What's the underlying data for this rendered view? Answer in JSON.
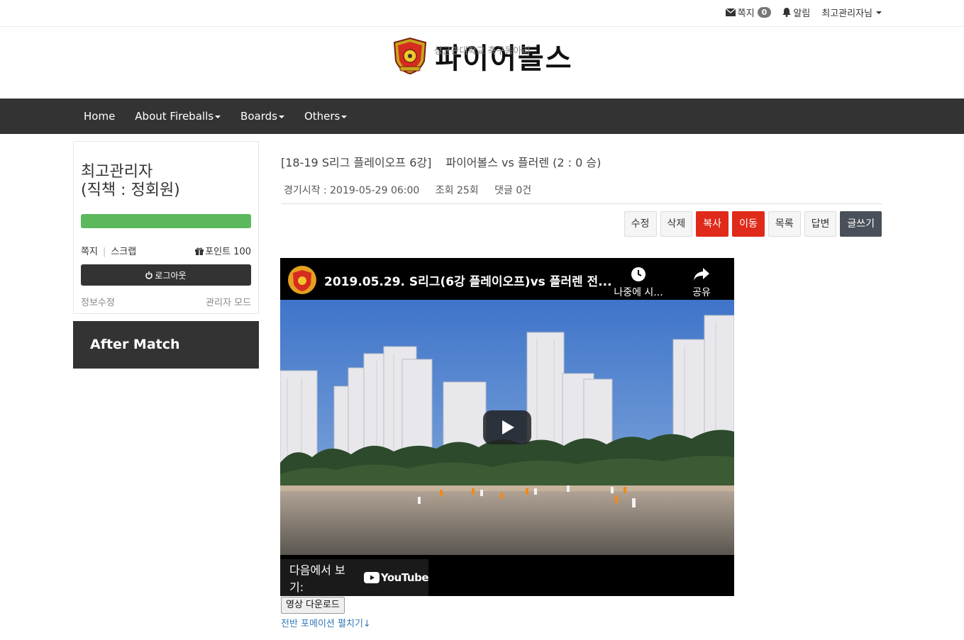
{
  "topbar": {
    "messages_label": "쪽지",
    "messages_count": "0",
    "alerts_label": "알림",
    "user_label": "최고관리자님"
  },
  "brand": {
    "title": "파이어볼스",
    "subtitle": "성균관대학교 축구동아리"
  },
  "nav": {
    "items": [
      {
        "label": "Home"
      },
      {
        "label": "About Fireballs"
      },
      {
        "label": "Boards"
      },
      {
        "label": "Others"
      }
    ]
  },
  "profile": {
    "name_line1": "최고관리자",
    "name_line2": "(직책 : 정회원)",
    "progress": 1.0,
    "progress_color": "#5cb85c",
    "messages_link": "쪽지",
    "scrap_link": "스크랩",
    "points_label": "포인트 100",
    "logout_label": "로그아웃",
    "edit_info": "정보수정",
    "admin_mode": "관리자 모드"
  },
  "sidebar_box": {
    "title": "After Match"
  },
  "post": {
    "category": "[18-19 S리그 플레이오프 6강]",
    "title": "파이어볼스 vs 플러렌 (2 : 0 승)",
    "match_start": "경기시작 : 2019-05-29 06:00",
    "views": "조회 25회",
    "comments": "댓글 0건"
  },
  "actions": {
    "edit": "수정",
    "delete": "삭제",
    "copy": "복사",
    "move": "이동",
    "list": "목록",
    "reply": "답변",
    "write": "글쓰기"
  },
  "video": {
    "title": "2019.05.29. S리그(6강 플레이오프)vs 플러렌 전...",
    "watch_later": "나중에 시...",
    "share": "공유",
    "watch_on": "다음에서 보기:",
    "youtube": "YouTube"
  },
  "download_button": "영상 다운로드",
  "formation_link": "전반 포메이션 펼치기↓",
  "colors": {
    "nav_bg": "#333333",
    "red_button": "#e02a1a",
    "dark_button": "#4a5059",
    "link": "#337ab7"
  }
}
